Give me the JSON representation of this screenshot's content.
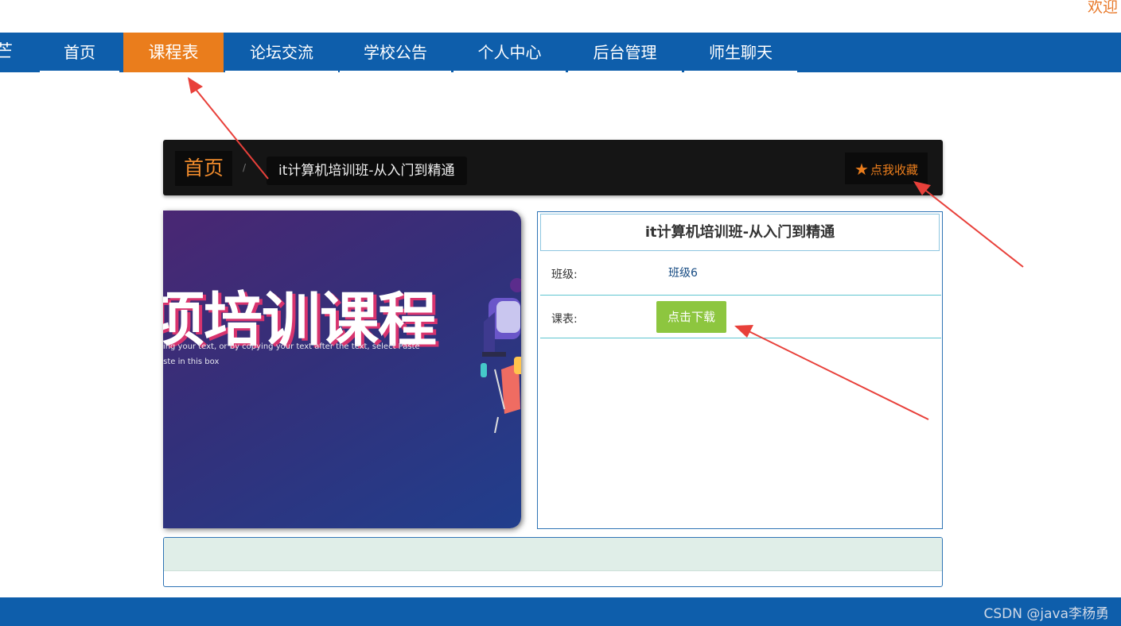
{
  "header": {
    "welcome_text": "欢迎",
    "nav_cut_glyph": "芒"
  },
  "nav": {
    "items": [
      {
        "label": "首页",
        "active": false
      },
      {
        "label": "课程表",
        "active": true
      },
      {
        "label": "论坛交流",
        "active": false
      },
      {
        "label": "学校公告",
        "active": false
      },
      {
        "label": "个人中心",
        "active": false
      },
      {
        "label": "后台管理",
        "active": false
      },
      {
        "label": "师生聊天",
        "active": false
      }
    ]
  },
  "breadcrumb": {
    "home": "首页",
    "separator": "/",
    "current": "it计算机培训班-从入门到精通",
    "favorite_label": "点我收藏",
    "favorite_icon": "star-icon"
  },
  "banner": {
    "headline": "项培训课程",
    "subtext_line1": "ying your text, or by copying your text after the text, select Paste",
    "subtext_line2": "aste in this box"
  },
  "detail": {
    "title": "it计算机培训班-从入门到精通",
    "class_label": "班级:",
    "class_value": "班级6",
    "schedule_label": "课表:",
    "download_label": "点击下载"
  },
  "footer": {
    "watermark": "CSDN @java李杨勇"
  },
  "colors": {
    "nav_blue": "#0e5eab",
    "active_orange": "#ea7d1c",
    "download_green": "#8dc63f",
    "annotation_red": "#e8403a"
  }
}
